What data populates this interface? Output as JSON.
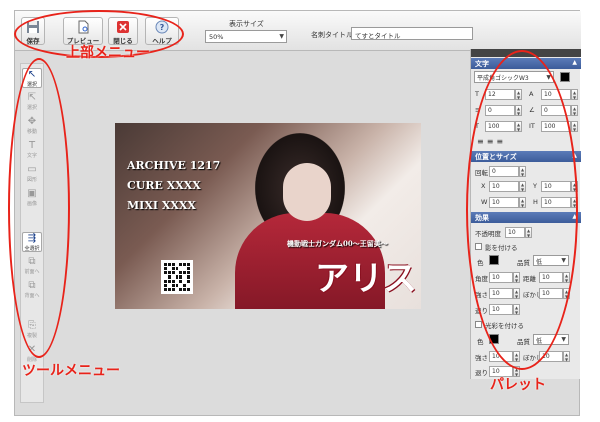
{
  "toolbar": {
    "save": "保存",
    "preview": "プレビュー",
    "close": "閉じる",
    "help": "ヘルプ",
    "display_size_label": "表示サイズ",
    "display_size_value": "50%",
    "title_label": "名刺タイトル",
    "title_value": "てすとタイトル"
  },
  "tools": [
    {
      "label": "選択",
      "icon": "↖"
    },
    {
      "label": "選択",
      "icon": "⇱"
    },
    {
      "label": "移動",
      "icon": "✥"
    },
    {
      "label": "文字",
      "icon": "T"
    },
    {
      "label": "図形",
      "icon": "▭"
    },
    {
      "label": "画像",
      "icon": "▣"
    },
    {
      "label": "全選択",
      "icon": "⇶"
    },
    {
      "label": "前面へ",
      "icon": "⧉"
    },
    {
      "label": "背面へ",
      "icon": "⧉"
    },
    {
      "label": "複製",
      "icon": "⎘"
    },
    {
      "label": "削除",
      "icon": "✕"
    }
  ],
  "canvas": {
    "line1": "ARCHIVE 1217",
    "line2": "CURE XXXX",
    "line3": "MIXI XXXX",
    "subtitle": "機動戦士ガンダム00～王留美～",
    "name": "アリス"
  },
  "palette": {
    "text_section": "文字",
    "font": "平成角ゴシックW3",
    "font_size": "12",
    "char_spacing": "10",
    "line_height": "0",
    "rotation": "0",
    "width_scale": "100",
    "height_scale": "100",
    "pos_section": "位置とサイズ",
    "rotate_label": "回転",
    "rotate": "0",
    "x_label": "X",
    "x": "10",
    "y_label": "Y",
    "y": "10",
    "w_label": "W",
    "w": "10",
    "h_label": "H",
    "h": "10",
    "effect_section": "効果",
    "opacity_label": "不透明度",
    "opacity": "10",
    "shadow_label": "影を付ける",
    "color_label": "色",
    "quality_label": "品質",
    "quality": "低",
    "angle_label": "角度",
    "angle": "10",
    "distance_label": "距離",
    "distance": "10",
    "strength_label": "強さ",
    "strength": "10",
    "blur_label": "ぼかし",
    "blur": "10",
    "spread_label": "退り",
    "spread": "10",
    "glow_label": "光彩を付ける",
    "glow_color_label": "色",
    "glow_quality_label": "品質",
    "glow_quality": "低",
    "glow_strength_label": "強さ",
    "glow_strength": "10",
    "glow_blur_label": "ぼかし",
    "glow_blur": "10",
    "glow_spread_label": "退り",
    "glow_spread": "10"
  },
  "annotations": {
    "top_menu": "上部メニュー",
    "tool_menu": "ツールメニュー",
    "palette": "パレット"
  },
  "colors": {
    "annotation": "#e8231a",
    "palette_header": "#4a6aa8"
  }
}
